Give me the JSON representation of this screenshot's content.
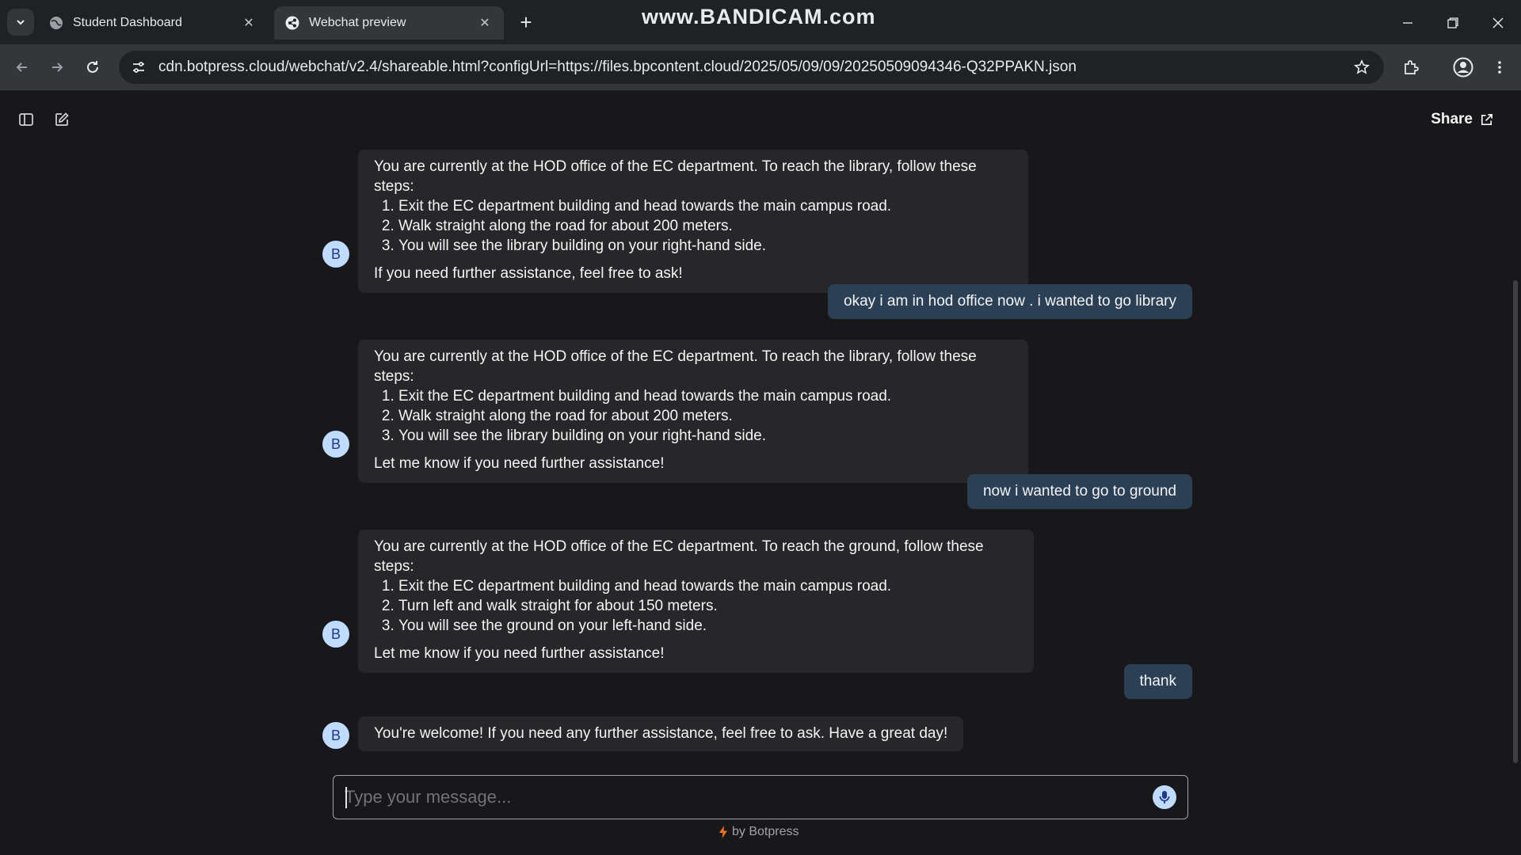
{
  "browser": {
    "tabs": [
      {
        "title": "Student Dashboard",
        "active": false
      },
      {
        "title": "Webchat preview",
        "active": true
      }
    ],
    "watermark": "www.BANDICAM.com",
    "url": "cdn.botpress.cloud/webchat/v2.4/shareable.html?configUrl=https://files.bpcontent.cloud/2025/05/09/09/20250509094346-Q32PPAKN.json"
  },
  "header": {
    "share_label": "Share"
  },
  "messages": [
    {
      "role": "bot",
      "avatar": "B",
      "intro": "You are currently at the HOD office of the EC department. To reach the library, follow these steps:",
      "steps": [
        "Exit the EC department building and head towards the main campus road.",
        "Walk straight along the road for about 200 meters.",
        "You will see the library building on your right-hand side."
      ],
      "outro": "If you need further assistance, feel free to ask!"
    },
    {
      "role": "user",
      "text": "okay i am in hod office now . i wanted to go library"
    },
    {
      "role": "bot",
      "avatar": "B",
      "intro": "You are currently at the HOD office of the EC department. To reach the library, follow these steps:",
      "steps": [
        "Exit the EC department building and head towards the main campus road.",
        "Walk straight along the road for about 200 meters.",
        "You will see the library building on your right-hand side."
      ],
      "outro": "Let me know if you need further assistance!"
    },
    {
      "role": "user",
      "text": "now i wanted to go to ground"
    },
    {
      "role": "bot",
      "avatar": "B",
      "intro": "You are currently at the HOD office of the EC department. To reach the ground, follow these steps:",
      "steps": [
        "Exit the EC department building and head towards the main campus road.",
        "Turn left and walk straight for about 150 meters.",
        "You will see the ground on your left-hand side."
      ],
      "outro": "Let me know if you need further assistance!"
    },
    {
      "role": "user",
      "text": "thank"
    },
    {
      "role": "bot",
      "avatar": "B",
      "text": "You're welcome! If you need any further assistance, feel free to ask. Have a great day!"
    }
  ],
  "composer": {
    "placeholder": "Type your message...",
    "value": ""
  },
  "footer": {
    "powered_by": "by Botpress"
  },
  "colors": {
    "background": "#18181b",
    "bot_bubble": "#27272a",
    "user_bubble": "#2b3f55",
    "avatar": "#bfdbfe",
    "accent_bolt": "#f97316"
  }
}
